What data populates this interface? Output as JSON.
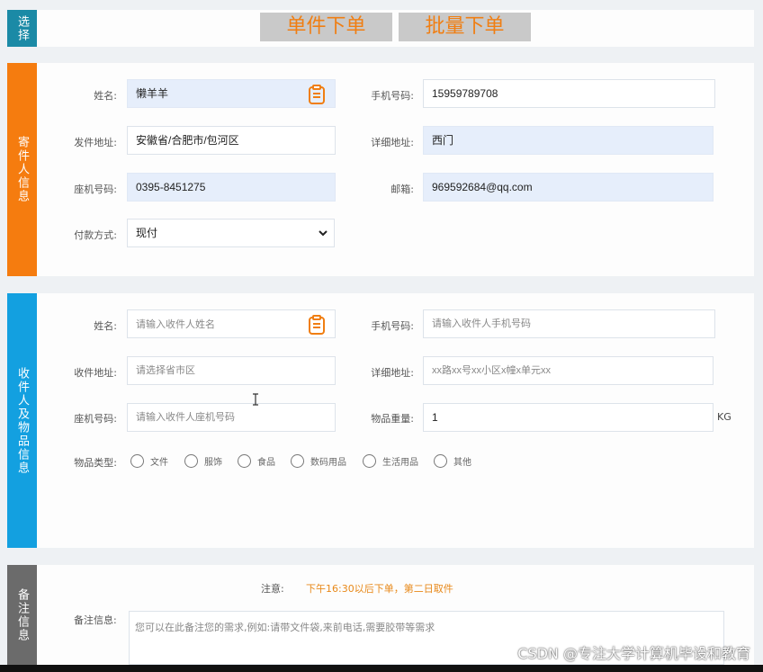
{
  "select": {
    "tab": "选择",
    "buttons": [
      "单件下单",
      "批量下单"
    ]
  },
  "sender": {
    "tab": "寄件人信息",
    "name_label": "姓名:",
    "name_value": "懒羊羊",
    "phone_label": "手机号码:",
    "phone_value": "15959789708",
    "address_label": "发件地址:",
    "address_value": "安徽省/合肥市/包河区",
    "detail_label": "详细地址:",
    "detail_value": "西门",
    "landline_label": "座机号码:",
    "landline_value": "0395-8451275",
    "email_label": "邮箱:",
    "email_value": "969592684@qq.com",
    "pay_label": "付款方式:",
    "pay_value": "现付"
  },
  "receiver": {
    "tab": "收件人及物品信息",
    "name_label": "姓名:",
    "name_placeholder": "请输入收件人姓名",
    "phone_label": "手机号码:",
    "phone_placeholder": "请输入收件人手机号码",
    "address_label": "收件地址:",
    "address_placeholder": "请选择省市区",
    "detail_label": "详细地址:",
    "detail_placeholder": "xx路xx号xx小区x幢x单元xx",
    "landline_label": "座机号码:",
    "landline_placeholder": "请输入收件人座机号码",
    "weight_label": "物品重量:",
    "weight_value": "1",
    "weight_unit": "KG",
    "type_label": "物品类型:",
    "types": [
      "文件",
      "服饰",
      "食品",
      "数码用品",
      "生活用品",
      "其他"
    ]
  },
  "notes": {
    "tab": "备注信息",
    "notice_label": "注意:",
    "notice_text": "下午16:30以后下单，第二日取件",
    "remark_label": "备注信息:",
    "remark_placeholder": "您可以在此备注您的需求,例如:请带文件袋,来前电话,需要胶带等需求"
  },
  "watermark": "CSDN @专注大学计算机毕设和教育",
  "colors": {
    "select_tab": "#1b8aa6",
    "sender_tab": "#f57c0f",
    "receiver_tab": "#13a0e0",
    "notes_tab": "#6b6b6b",
    "accent": "#f07e12"
  },
  "icons": [
    "clipboard-icon",
    "chevron-down-icon"
  ]
}
